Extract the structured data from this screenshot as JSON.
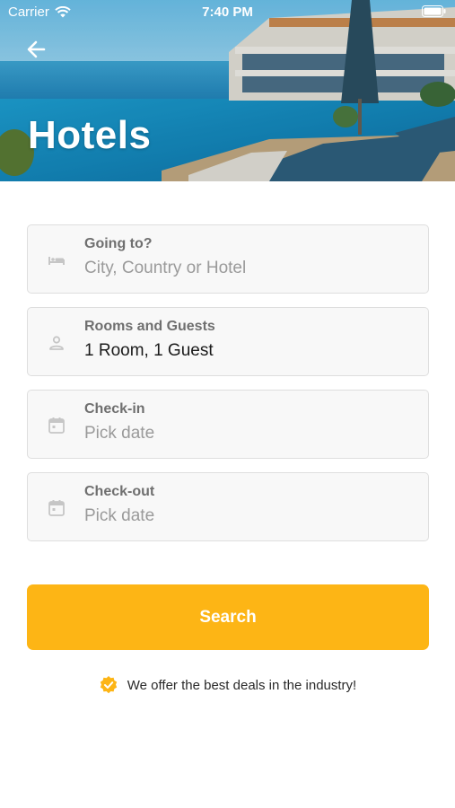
{
  "status_bar": {
    "carrier": "Carrier",
    "time": "7:40 PM"
  },
  "header": {
    "title": "Hotels",
    "back_icon": "arrow-left-icon"
  },
  "form": {
    "fields": [
      {
        "icon": "bed-icon",
        "label": "Going to?",
        "value": "City, Country or Hotel",
        "is_placeholder": true
      },
      {
        "icon": "person-icon",
        "label": "Rooms and Guests",
        "value": "1 Room, 1 Guest",
        "is_placeholder": false
      },
      {
        "icon": "calendar-icon",
        "label": "Check-in",
        "value": "Pick date",
        "is_placeholder": true
      },
      {
        "icon": "calendar-icon",
        "label": "Check-out",
        "value": "Pick date",
        "is_placeholder": true
      }
    ]
  },
  "search_button": {
    "label": "Search"
  },
  "deal_note": {
    "text": "We offer the best deals in the industry!",
    "icon": "verified-badge-icon"
  },
  "colors": {
    "accent": "#fdb515",
    "field_bg": "#f8f8f8",
    "field_border": "#dedede",
    "label": "#6f6f6f",
    "placeholder": "#9a9a9a",
    "value": "#1b1b1b"
  }
}
